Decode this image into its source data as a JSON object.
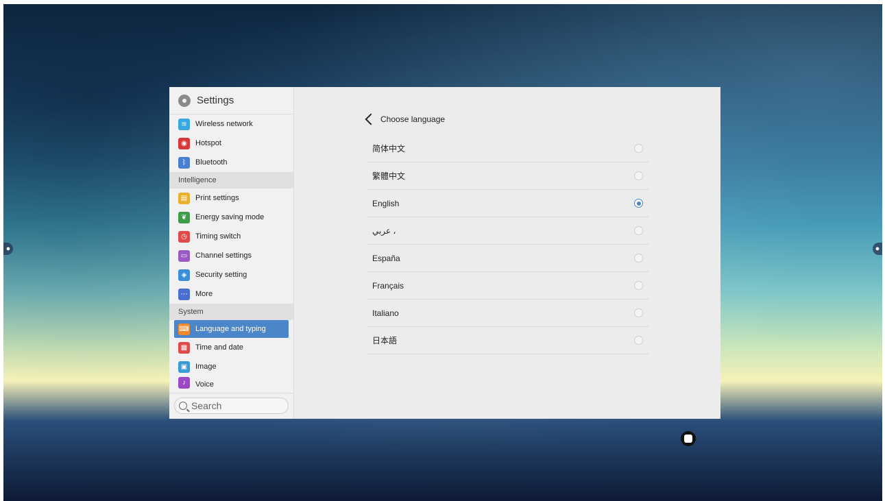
{
  "sidebar": {
    "title": "Settings",
    "items": [
      {
        "label": "Wireless network",
        "icon": "wifi-icon",
        "color": "#3aa8e0"
      },
      {
        "label": "Hotspot",
        "icon": "hotspot-icon",
        "color": "#d9383a"
      },
      {
        "label": "Bluetooth",
        "icon": "bluetooth-icon",
        "color": "#4a7fd0"
      }
    ],
    "section_intelligence": "Intelligence",
    "intelligence_items": [
      {
        "label": "Print settings",
        "icon": "printer-icon",
        "color": "#e8b02c"
      },
      {
        "label": "Energy saving mode",
        "icon": "leaf-icon",
        "color": "#3d9b4a"
      },
      {
        "label": "Timing switch",
        "icon": "clock-icon",
        "color": "#e04a4a"
      },
      {
        "label": "Channel settings",
        "icon": "channel-icon",
        "color": "#9a5ac4"
      },
      {
        "label": "Security setting",
        "icon": "shield-icon",
        "color": "#3a8fd8"
      },
      {
        "label": "More",
        "icon": "more-icon",
        "color": "#4a6fd0"
      }
    ],
    "section_system": "System",
    "system_items": [
      {
        "label": "Language and typing",
        "icon": "keyboard-icon",
        "color": "#f08a2a",
        "active": true
      },
      {
        "label": "Time and date",
        "icon": "calendar-icon",
        "color": "#e04a4a"
      },
      {
        "label": "Image",
        "icon": "image-icon",
        "color": "#3a9ad8"
      },
      {
        "label": "Voice",
        "icon": "speaker-icon",
        "color": "#9a4ac4"
      }
    ],
    "search_placeholder": "Search"
  },
  "main": {
    "back_title": "Choose language",
    "languages": [
      {
        "label": "简体中文",
        "selected": false
      },
      {
        "label": "繁體中文",
        "selected": false
      },
      {
        "label": "English",
        "selected": true
      },
      {
        "label": "عربي ،",
        "selected": false
      },
      {
        "label": "España",
        "selected": false
      },
      {
        "label": "Français",
        "selected": false
      },
      {
        "label": "Italiano",
        "selected": false
      },
      {
        "label": "日本語",
        "selected": false
      }
    ]
  },
  "accent_color": "#4a86c8"
}
